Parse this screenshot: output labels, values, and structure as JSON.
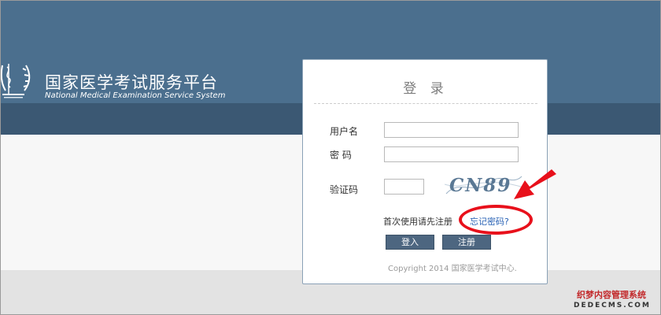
{
  "header": {
    "title_cn": "国家医学考试服务平台",
    "title_en": "National Medical Examination Service System"
  },
  "login": {
    "title": "登 录",
    "username_label": "用户名",
    "username_value": "",
    "password_label": "密 码",
    "password_value": "",
    "captcha_label": "验证码",
    "captcha_value": "",
    "captcha_text": "CN89",
    "first_use_text": "首次使用请先注册",
    "forgot_link": "忘记密码?",
    "login_button": "登入",
    "register_button": "注册",
    "copyright": "Copyright 2014 国家医学考试中心."
  },
  "watermark": {
    "cn": "织梦内容管理系统",
    "en": "DEDECMS.COM"
  },
  "colors": {
    "header_band": "#4b6f8e",
    "header_dark": "#3b5873",
    "button": "#4d6680",
    "link": "#2a62b5",
    "annotation": "#e8101b"
  }
}
